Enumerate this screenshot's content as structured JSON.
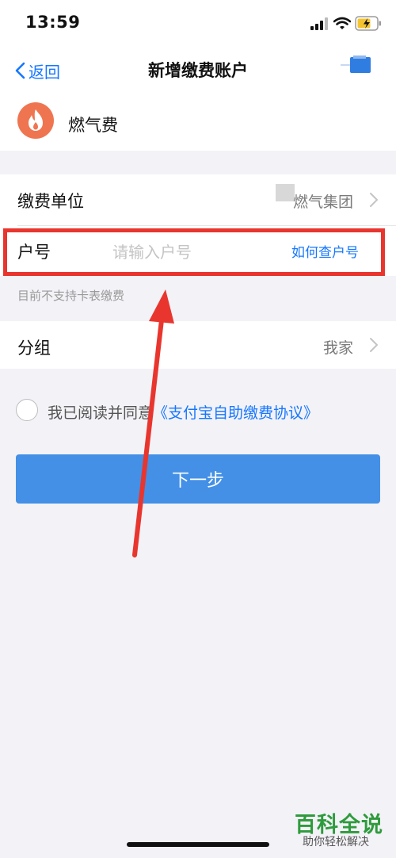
{
  "status_bar": {
    "time": "13:59"
  },
  "nav": {
    "back_label": "返回",
    "title": "新增缴费账户"
  },
  "biller": {
    "name": "燃气费",
    "icon": "flame-icon"
  },
  "form": {
    "unit": {
      "label": "缴费单位",
      "value": "燃气集团"
    },
    "account": {
      "label": "户号",
      "placeholder": "请输入户号",
      "help_link": "如何查户号"
    },
    "hint": "目前不支持卡表缴费",
    "group": {
      "label": "分组",
      "value": "我家"
    }
  },
  "agreement": {
    "prefix": "我已阅读并同意",
    "link": "《支付宝自助缴费协议》"
  },
  "next_button": {
    "label": "下一步"
  },
  "annotation": {
    "highlight_color": "#e8362f",
    "arrow_color": "#e8362f"
  },
  "watermark": {
    "title": "百科全说",
    "subtitle": "助你轻松解决"
  },
  "colors": {
    "accent": "#1677ff",
    "button": "#4390e6",
    "logo": "#ef7551"
  }
}
